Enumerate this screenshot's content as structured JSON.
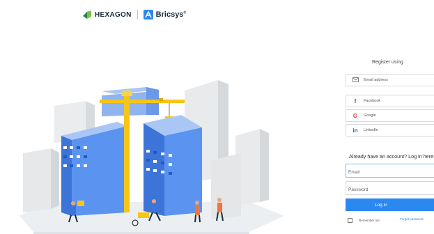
{
  "brand": {
    "hexagon_label": "HEXAGON",
    "bricsys_label": "Bricsys",
    "trademark": "®"
  },
  "auth": {
    "register_title": "Register using",
    "providers": [
      {
        "icon": "mail-icon",
        "label": "Email address"
      },
      {
        "icon": "facebook-icon",
        "label": "Facebook"
      },
      {
        "icon": "google-icon",
        "label": "Google"
      },
      {
        "icon": "linkedin-icon",
        "label": "LinkedIn"
      }
    ],
    "login_prompt": "Already have an account? Log in here:",
    "email_placeholder": "Email",
    "password_placeholder": "Password",
    "login_button": "Log in",
    "remember_me": "Remember me",
    "forgot_password": "Forgot password"
  },
  "colors": {
    "accent": "#2b88f0",
    "building_blue": "#4f8cf3",
    "crane_yellow": "#f5c518"
  }
}
